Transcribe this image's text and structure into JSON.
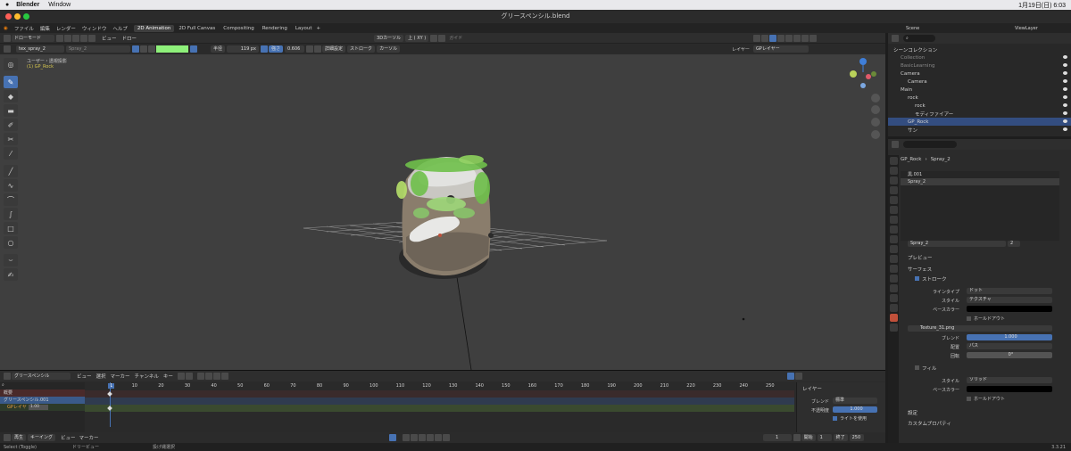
{
  "macmenu": {
    "apple": "",
    "app": "Blender",
    "window": "Window",
    "clock": "1月19日(日) 6:03"
  },
  "window": {
    "title": "グリースペンシル.blend"
  },
  "menu": {
    "items": [
      "ファイル",
      "編集",
      "レンダー",
      "ウィンドウ",
      "ヘルプ"
    ],
    "workspaces": [
      "2D Animation",
      "2D Full Canvas",
      "Compositing",
      "Rendering",
      "Layout"
    ],
    "add": "+"
  },
  "header": {
    "mode": "ドローモード",
    "view": "ビュー",
    "draw": "ドロー",
    "cursor": "3Dカーソル",
    "axis": "上 ( XY )",
    "guide": "ガイド"
  },
  "toolheader": {
    "brush": "tex_spray_2",
    "material": "Spray_2",
    "radius_label": "半径",
    "radius": "119 px",
    "strength_label": "強さ",
    "strength": "0.606",
    "advanced": "詳細設定",
    "stroke": "ストローク",
    "cursor": "カーソル",
    "layer_label": "レイヤー",
    "layer": "GPレイヤー"
  },
  "viewport": {
    "line1": "ユーザー・透視投影",
    "line2": "(1) GP_Rock"
  },
  "timeline": {
    "editor": "グリースペンシル",
    "menus": [
      "ビュー",
      "選択",
      "マーカー",
      "チャンネル",
      "キー"
    ],
    "ticks": [
      "1",
      "10",
      "20",
      "30",
      "40",
      "50",
      "60",
      "70",
      "80",
      "90",
      "100",
      "110",
      "120",
      "130",
      "140",
      "150",
      "160",
      "170",
      "180",
      "190",
      "200",
      "210",
      "220",
      "230",
      "240",
      "250"
    ],
    "summary": "概要",
    "object": "グリースペンシル.001",
    "layer": "GPレイヤ",
    "layer_val": "1.00",
    "current": "1",
    "side": {
      "title": "レイヤー",
      "blend_label": "ブレンド",
      "blend": "標準",
      "opacity_label": "不透明度",
      "opacity": "1.000",
      "light": "ライトを使用"
    }
  },
  "playback": {
    "play": "再生",
    "keying": "キーイング",
    "view": "ビュー",
    "marker": "マーカー",
    "frame": "1",
    "start_label": "開始",
    "start": "1",
    "end_label": "終了",
    "end": "250"
  },
  "status": {
    "select": "Select (Toggle)",
    "dolly": "ドリービュー",
    "lasso": "投げ縄選択",
    "version": "3.3.21"
  },
  "outliner": {
    "scene": "Scene",
    "viewlayer": "ViewLayer",
    "rows": [
      {
        "name": "シーンコレクション",
        "indent": 0
      },
      {
        "name": "Collection",
        "indent": 1,
        "dim": true
      },
      {
        "name": "BasicLearning",
        "indent": 1,
        "dim": true
      },
      {
        "name": "Camera",
        "indent": 1
      },
      {
        "name": "Camera",
        "indent": 2
      },
      {
        "name": "Main",
        "indent": 1
      },
      {
        "name": "rock",
        "indent": 2
      },
      {
        "name": "rock",
        "indent": 3
      },
      {
        "name": "モディファイアー",
        "indent": 3
      },
      {
        "name": "GP_Rock",
        "indent": 2,
        "sel": true
      },
      {
        "name": "サン",
        "indent": 2
      }
    ]
  },
  "props": {
    "crumb1": "GP_Rock",
    "crumb2": "Spray_2",
    "slots": [
      "黒.001",
      "Spray_2"
    ],
    "matname": "Spray_2",
    "users": "2",
    "preview": "プレビュー",
    "surface": "サーフェス",
    "stroke": "ストローク",
    "linetype_label": "ラインタイプ",
    "linetype": "ドット",
    "style_label": "スタイル",
    "style": "テクスチャ",
    "basecolor_label": "ベースカラー",
    "holdout": "ホールドアウト",
    "texture": "Texture_31.png",
    "blend_label": "ブレンド",
    "blend": "1.000",
    "align_label": "配置",
    "align": "パス",
    "rotation_label": "回転",
    "rotation": "0°",
    "fill": "フィル",
    "fstyle_label": "スタイル",
    "fstyle": "ソリッド",
    "fbase_label": "ベースカラー",
    "fholdout": "ホールドアウト",
    "settings": "設定",
    "custom": "カスタムプロパティ"
  },
  "colors": {
    "accent": "#4772b3",
    "green": "#8ef07a",
    "stroke_blue": "#4772b3"
  }
}
